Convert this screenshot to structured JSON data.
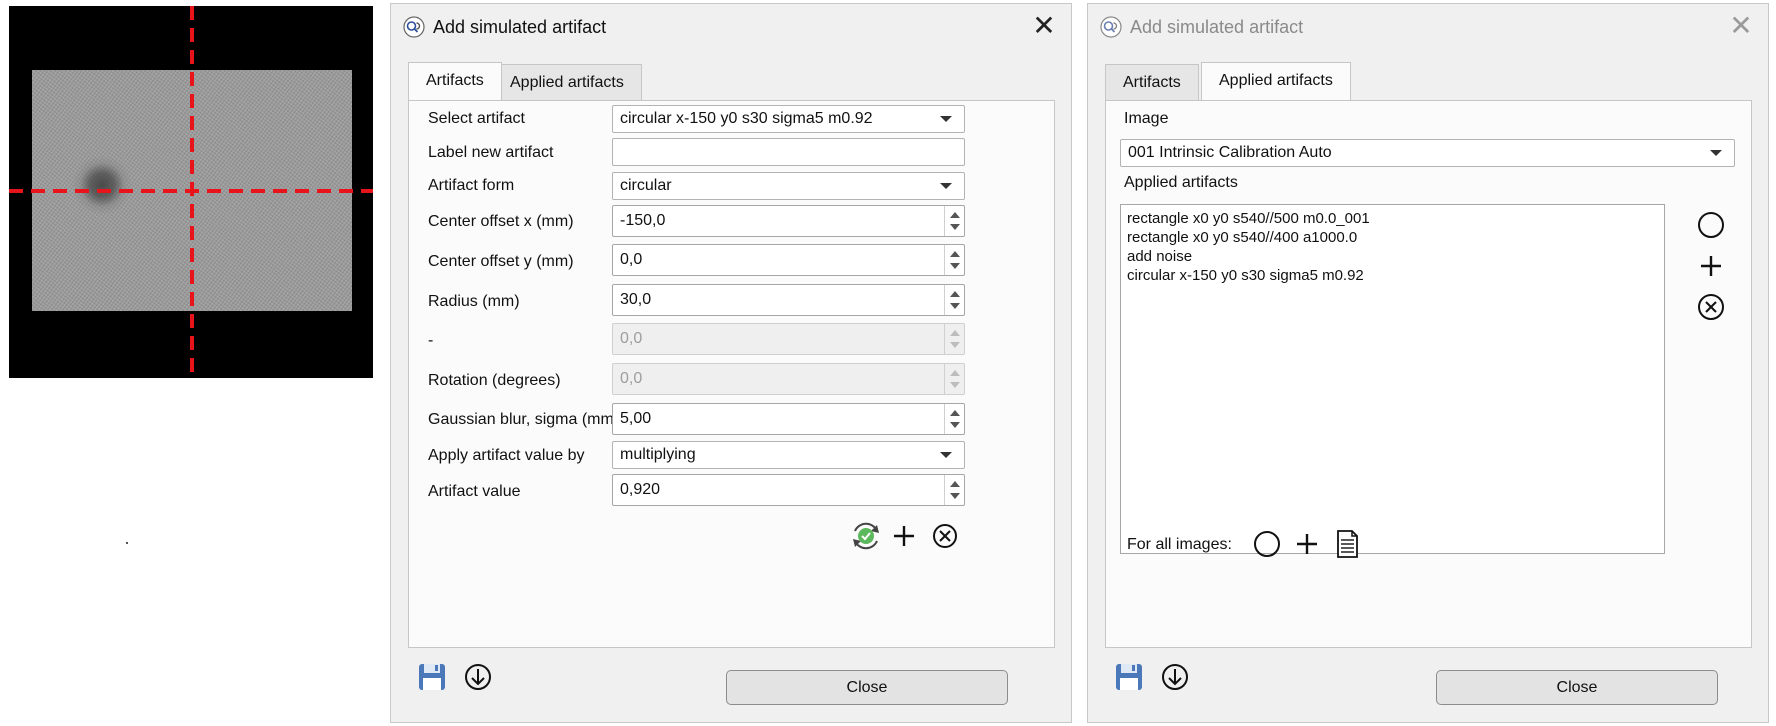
{
  "dialog_left": {
    "title": "Add simulated artifact",
    "tabs": [
      "Artifacts",
      "Applied artifacts"
    ],
    "fields": {
      "select_artifact": {
        "label": "Select artifact",
        "value": "circular x-150 y0 s30 sigma5 m0.92"
      },
      "label_new": {
        "label": "Label new artifact",
        "value": ""
      },
      "artifact_form": {
        "label": "Artifact form",
        "value": "circular"
      },
      "center_x": {
        "label": "Center offset x (mm)",
        "value": "-150,0"
      },
      "center_y": {
        "label": "Center offset y (mm)",
        "value": "0,0"
      },
      "radius": {
        "label": "Radius (mm)",
        "value": "30,0"
      },
      "dash": {
        "label": "-",
        "value": "0,0"
      },
      "rotation": {
        "label": "Rotation (degrees)",
        "value": "0,0"
      },
      "sigma": {
        "label": "Gaussian blur, sigma (mm)",
        "value": "5,00"
      },
      "apply_by": {
        "label": "Apply artifact value by",
        "value": "multiplying"
      },
      "artifact_value": {
        "label": "Artifact value",
        "value": "0,920"
      }
    },
    "close_label": "Close"
  },
  "dialog_right": {
    "title": "Add simulated artifact",
    "tabs": [
      "Artifacts",
      "Applied artifacts"
    ],
    "image_label": "Image",
    "image_value": "001  Intrinsic Calibration Auto",
    "applied_label": "Applied artifacts",
    "applied_items": [
      "rectangle x0 y0 s540//500 m0.0_001",
      "rectangle x0 y0 s540//400 a1000.0",
      "add noise",
      "circular x-150 y0 s30 sigma5 m0.92"
    ],
    "for_all_label": "For all images:",
    "close_label": "Close"
  },
  "icons": {
    "app": "search-app-icon",
    "apply": "check-refresh-icon",
    "add": "plus-icon",
    "remove": "circle-x-icon",
    "clear": "circle-icon",
    "save": "floppy-disk-icon",
    "load": "download-circle-icon",
    "document": "document-icon"
  },
  "colors": {
    "crosshair": "#e8131b",
    "save_icon": "#4a78b8",
    "check_icon": "#3a9a3a"
  }
}
